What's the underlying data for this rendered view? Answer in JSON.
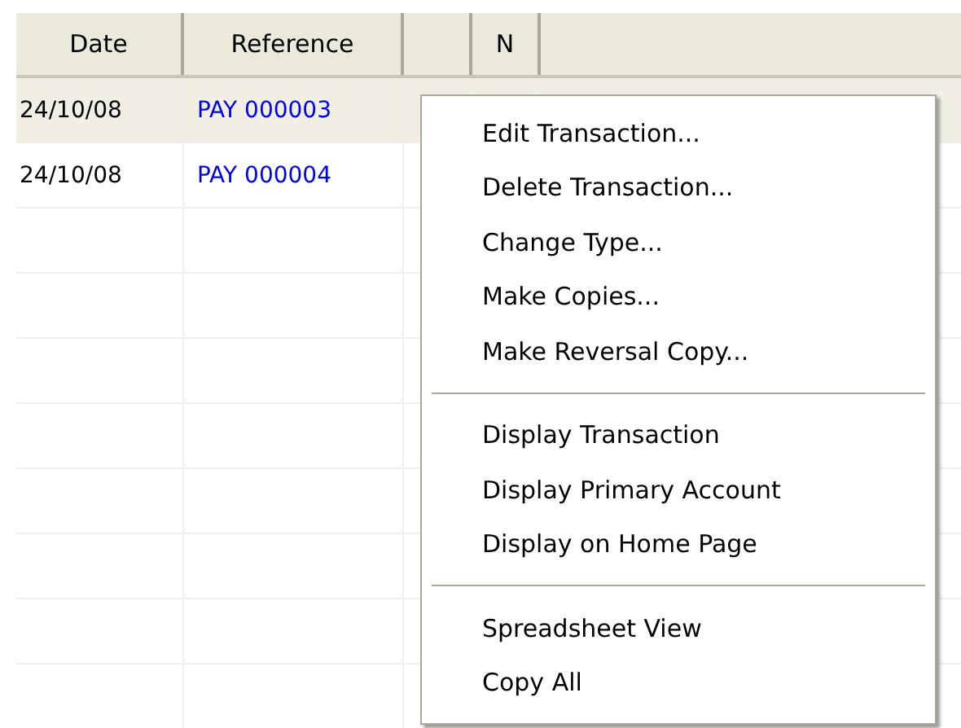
{
  "table": {
    "columns": [
      {
        "kind": "text",
        "label": "Date"
      },
      {
        "kind": "text",
        "label": "Reference"
      },
      {
        "kind": "blank"
      },
      {
        "kind": "text",
        "label": "N"
      }
    ],
    "rows": [
      {
        "selected": true,
        "date": "24/10/08",
        "reference": "PAY 000003"
      },
      {
        "selected": false,
        "date": "24/10/08",
        "reference": "PAY 000004"
      }
    ]
  },
  "context_menu": {
    "items": [
      {
        "kind": "item",
        "label": "Edit Transaction..."
      },
      {
        "kind": "item",
        "label": "Delete Transaction..."
      },
      {
        "kind": "item",
        "label": "Change Type..."
      },
      {
        "kind": "item",
        "label": "Make Copies..."
      },
      {
        "kind": "item",
        "label": "Make Reversal Copy..."
      },
      {
        "kind": "separator"
      },
      {
        "kind": "item",
        "label": "Display Transaction"
      },
      {
        "kind": "item",
        "label": "Display Primary Account"
      },
      {
        "kind": "item",
        "label": "Display on Home Page"
      },
      {
        "kind": "separator"
      },
      {
        "kind": "item",
        "label": "Spreadsheet View"
      },
      {
        "kind": "item",
        "label": "Copy All"
      }
    ]
  }
}
